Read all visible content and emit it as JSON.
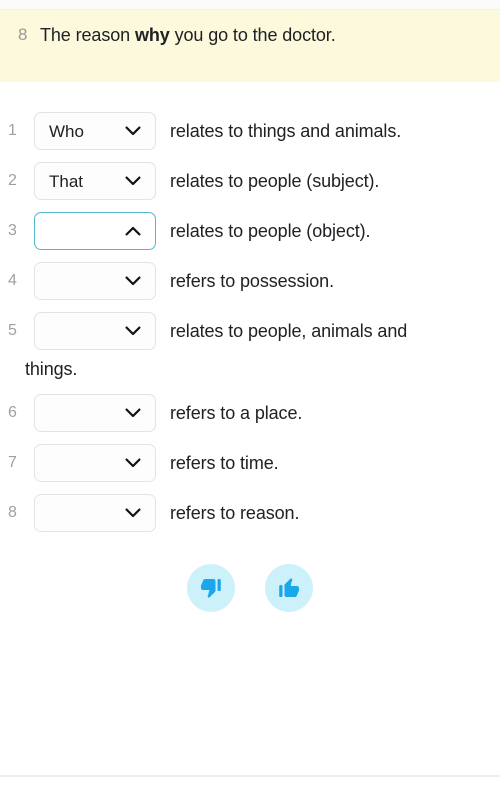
{
  "prompt": {
    "number": "8",
    "text_before": "The reason ",
    "text_bold": "why",
    "text_after": " you go to the doctor."
  },
  "colors": {
    "prompt_band": "#fcf9dd",
    "active_border": "#53b8c7",
    "thumb_bg": "#cdf1fb",
    "thumb_fg": "#1aa7ec",
    "text": "#202124",
    "number": "#a0a0a0",
    "select_border": "#e2e3e5"
  },
  "rows": [
    {
      "number": "1",
      "value": "Who",
      "placeholder": "",
      "chevron": "chevron-down-icon",
      "active": false,
      "description": "relates to things and animals.",
      "wrapped": ""
    },
    {
      "number": "2",
      "value": "That",
      "placeholder": "",
      "chevron": "chevron-down-icon",
      "active": false,
      "description": "relates to people (subject).",
      "wrapped": ""
    },
    {
      "number": "3",
      "value": "",
      "placeholder": "",
      "chevron": "chevron-up-icon",
      "active": true,
      "description": "relates to people (object).",
      "wrapped": ""
    },
    {
      "number": "4",
      "value": "",
      "placeholder": "",
      "chevron": "chevron-down-icon",
      "active": false,
      "description": "refers to possession.",
      "wrapped": ""
    },
    {
      "number": "5",
      "value": "",
      "placeholder": "",
      "chevron": "chevron-down-icon",
      "active": false,
      "description": "relates to people, animals and",
      "wrapped": "things."
    },
    {
      "number": "6",
      "value": "",
      "placeholder": "",
      "chevron": "chevron-down-icon",
      "active": false,
      "description": "refers to a place.",
      "wrapped": ""
    },
    {
      "number": "7",
      "value": "",
      "placeholder": "",
      "chevron": "chevron-down-icon",
      "active": false,
      "description": "refers to time.",
      "wrapped": ""
    },
    {
      "number": "8",
      "value": "",
      "placeholder": "",
      "chevron": "chevron-down-icon",
      "active": false,
      "description": "refers to reason.",
      "wrapped": ""
    }
  ],
  "feedback": {
    "thumbs_down_icon": "thumbs-down-icon",
    "thumbs_up_icon": "thumbs-up-icon"
  }
}
